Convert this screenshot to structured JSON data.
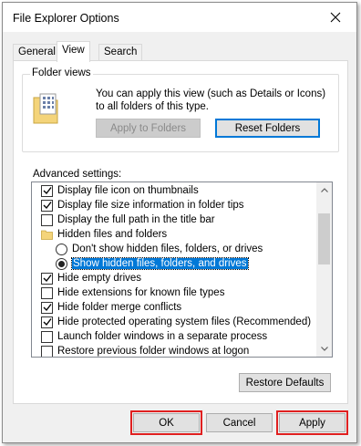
{
  "window": {
    "title": "File Explorer Options"
  },
  "tabs": [
    {
      "label": "General",
      "active": false
    },
    {
      "label": "View",
      "active": true
    },
    {
      "label": "Search",
      "active": false
    }
  ],
  "folder_views": {
    "group_label": "Folder views",
    "description": "You can apply this view (such as Details or Icons) to all folders of this type.",
    "apply_button": "Apply to Folders",
    "reset_button": "Reset Folders"
  },
  "advanced": {
    "label": "Advanced settings:",
    "items": [
      {
        "type": "checkbox",
        "checked": true,
        "label": "Display file icon on thumbnails"
      },
      {
        "type": "checkbox",
        "checked": true,
        "label": "Display file size information in folder tips"
      },
      {
        "type": "checkbox",
        "checked": false,
        "label": "Display the full path in the title bar"
      },
      {
        "type": "folder",
        "label": "Hidden files and folders"
      },
      {
        "type": "radio",
        "checked": false,
        "label": "Don't show hidden files, folders, or drives"
      },
      {
        "type": "radio",
        "checked": true,
        "selected": true,
        "label": "Show hidden files, folders, and drives"
      },
      {
        "type": "checkbox",
        "checked": true,
        "label": "Hide empty drives"
      },
      {
        "type": "checkbox",
        "checked": false,
        "label": "Hide extensions for known file types"
      },
      {
        "type": "checkbox",
        "checked": true,
        "label": "Hide folder merge conflicts"
      },
      {
        "type": "checkbox",
        "checked": true,
        "label": "Hide protected operating system files (Recommended)"
      },
      {
        "type": "checkbox",
        "checked": false,
        "label": "Launch folder windows in a separate process"
      },
      {
        "type": "checkbox",
        "checked": false,
        "label": "Restore previous folder windows at logon"
      }
    ],
    "restore_button": "Restore Defaults"
  },
  "footer": {
    "ok": "OK",
    "cancel": "Cancel",
    "apply": "Apply"
  },
  "colors": {
    "highlight": "#e02020",
    "selection": "#0078d7",
    "focus_border": "#0078d7"
  }
}
